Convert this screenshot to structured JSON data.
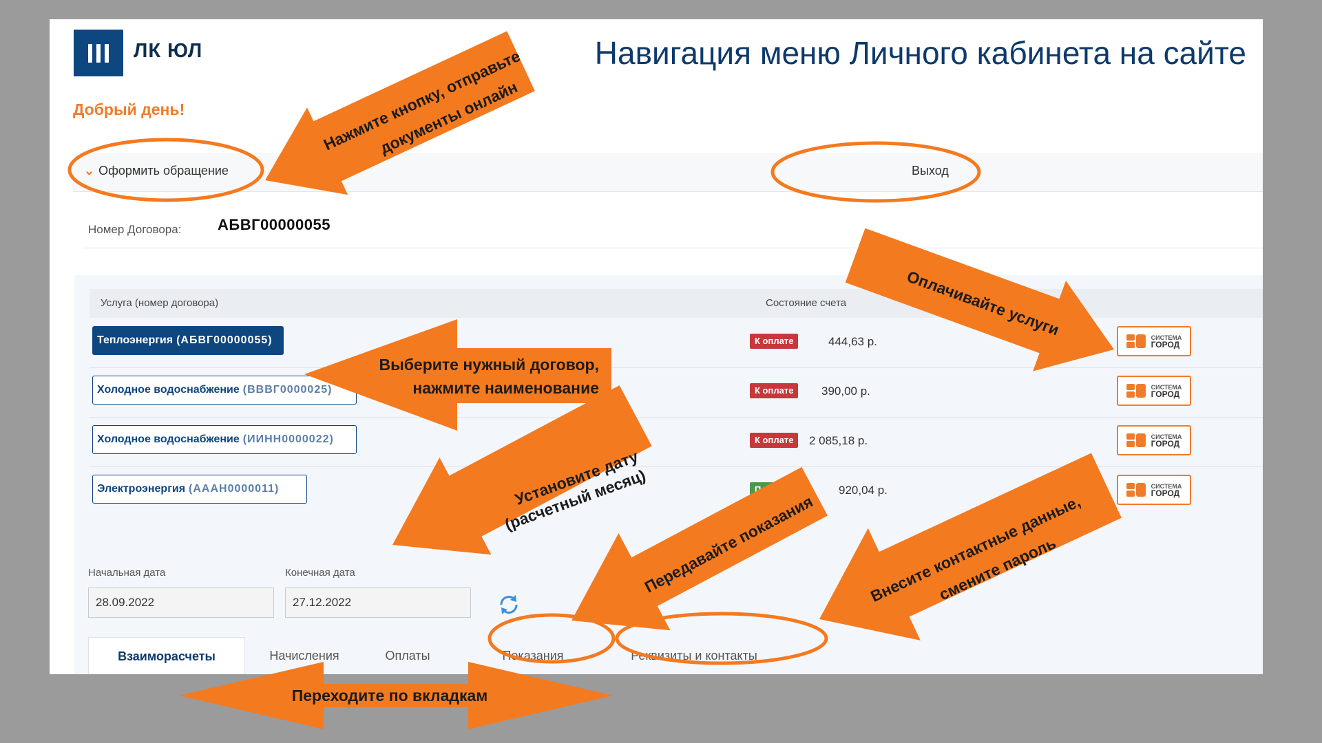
{
  "slide": {
    "title": "Навигация меню Личного кабинета на сайте",
    "logo_text": "ЛК ЮЛ"
  },
  "app": {
    "greeting": "Добрый день!",
    "menu": {
      "new_request": "Оформить обращение",
      "logout": "Выход"
    },
    "contract": {
      "label": "Номер Договора:",
      "value": "АБВГ00000055"
    },
    "table": {
      "headers": {
        "service": "Услуга (номер договора)",
        "status": "Состояние счета"
      },
      "rows": [
        {
          "service": "Теплоэнергия",
          "number": "(АБВГ00000055)",
          "status": "К оплате",
          "status_type": "due",
          "amount": "444,63 р.",
          "active": true
        },
        {
          "service": "Холодное водоснабжение",
          "number": "(ВВВГ0000025)",
          "status": "К оплате",
          "status_type": "due",
          "amount": "390,00 р.",
          "active": false
        },
        {
          "service": "Холодное водоснабжение",
          "number": "(ИИНН0000022)",
          "status": "К оплате",
          "status_type": "due",
          "amount": "2 085,18 р.",
          "active": false
        },
        {
          "service": "Электроэнергия",
          "number": "(АААН0000011)",
          "status": "Переплата",
          "status_type": "over",
          "amount": "920,04 р.",
          "active": false
        }
      ],
      "pay_button": {
        "line1": "СИСТЕМА",
        "line2": "ГОРОД"
      }
    },
    "dates": {
      "start_label": "Начальная дата",
      "start_value": "28.09.2022",
      "end_label": "Конечная дата",
      "end_value": "27.12.2022"
    },
    "tabs": [
      "Взаиморасчеты",
      "Начисления",
      "Оплаты",
      "Показания",
      "Реквизиты и контакты"
    ]
  },
  "annotations": {
    "send_documents": [
      "Нажмите кнопку, отправьте",
      "документы онлайн"
    ],
    "pay_services": "Оплачивайте услуги",
    "choose_contract": [
      "Выберите нужный договор,",
      "нажмите наименование"
    ],
    "set_date": [
      "Установите дату",
      "(расчетный месяц)"
    ],
    "submit_readings": "Передавайте показания",
    "contacts": [
      "Внесите контактные данные,",
      "смените пароль"
    ],
    "switch_tabs": "Переходите по вкладкам"
  },
  "colors": {
    "annotation_orange": "#f47a20",
    "brand_blue": "#0e4680",
    "greeting_orange": "#f07b2a",
    "status_due": "#c7373b",
    "status_over": "#4a9a4a"
  }
}
